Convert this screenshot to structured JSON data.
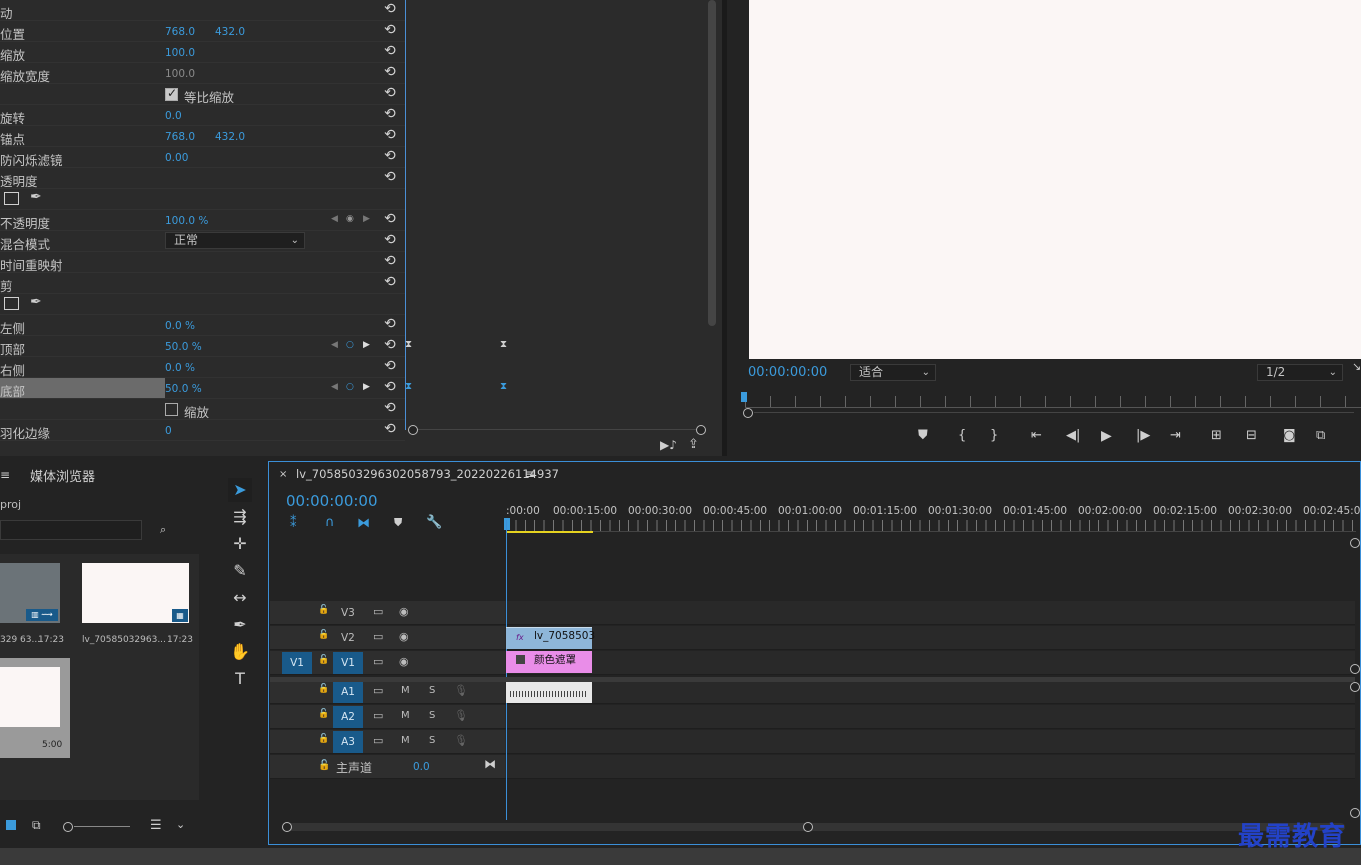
{
  "effect_controls": {
    "rows": [
      {
        "label": "动",
        "v1": "",
        "v2": ""
      },
      {
        "label": "位置",
        "v1": "768.0",
        "v2": "432.0"
      },
      {
        "label": "缩放",
        "v1": "100.0",
        "v2": ""
      },
      {
        "label": "缩放宽度",
        "v1": "",
        "v2": "",
        "vg": "100.0"
      },
      {
        "label": "",
        "v1": "",
        "v2": ""
      },
      {
        "label": "旋转",
        "v1": "0.0",
        "v2": ""
      },
      {
        "label": "锚点",
        "v1": "768.0",
        "v2": "432.0"
      },
      {
        "label": "防闪烁滤镜",
        "v1": "0.00",
        "v2": ""
      },
      {
        "label": "透明度",
        "v1": "",
        "v2": ""
      },
      {
        "label": "",
        "v1": "",
        "v2": ""
      },
      {
        "label": "不透明度",
        "v1": "100.0 %",
        "v2": ""
      },
      {
        "label": "混合模式",
        "v1": "",
        "v2": ""
      },
      {
        "label": "时间重映射",
        "v1": "",
        "v2": ""
      },
      {
        "label": "剪",
        "v1": "",
        "v2": ""
      },
      {
        "label": "",
        "v1": "",
        "v2": ""
      },
      {
        "label": "左侧",
        "v1": "0.0 %",
        "v2": ""
      },
      {
        "label": "顶部",
        "v1": "50.0 %",
        "v2": ""
      },
      {
        "label": "右侧",
        "v1": "0.0 %",
        "v2": ""
      },
      {
        "label": "底部",
        "v1": "50.0 %",
        "v2": ""
      },
      {
        "label": "",
        "v1": "",
        "v2": ""
      },
      {
        "label": "羽化边缘",
        "v1": "0",
        "v2": ""
      }
    ],
    "uniform_scale_label": "等比缩放",
    "blend_mode_value": "正常",
    "zoom_label": "缩放"
  },
  "program_monitor": {
    "timecode": "00:00:00:00",
    "fit_value": "适合",
    "quality_value": "1/2"
  },
  "project": {
    "media_browser_tab": "媒体浏览器",
    "project_name": "proj",
    "items": [
      {
        "name": "lv_70585032963...",
        "duration": "17:23"
      },
      {
        "name": "lv_70585032963...",
        "duration": "17:23"
      },
      {
        "name": "",
        "duration": "5:00"
      }
    ],
    "left_item_cap": "329 63..."
  },
  "timeline": {
    "sequence_title": "lv_7058503296302058793_20220226114937",
    "timecode": "00:00:00:00",
    "ruler_labels": [
      ":00:00",
      "00:00:15:00",
      "00:00:30:00",
      "00:00:45:00",
      "00:01:00:00",
      "00:01:15:00",
      "00:01:30:00",
      "00:01:45:00",
      "00:02:00:00",
      "00:02:15:00",
      "00:02:30:00",
      "00:02:45:0"
    ],
    "video_tracks": [
      "V3",
      "V2",
      "V1"
    ],
    "audio_tracks": [
      "A1",
      "A2",
      "A3"
    ],
    "source_patch": "V1",
    "master_label": "主声道",
    "master_value": "0.0",
    "mute_label": "M",
    "solo_label": "S",
    "clips": {
      "v2_clip": "lv_7058503",
      "v1_clip": "颜色遮罩"
    }
  },
  "watermark": "最需教育"
}
